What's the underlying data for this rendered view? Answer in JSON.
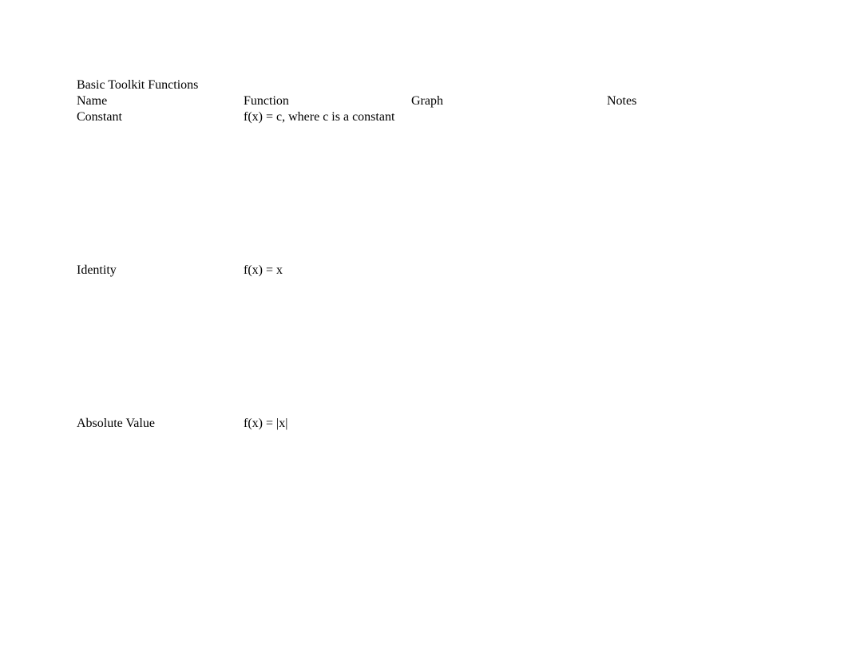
{
  "title": "Basic Toolkit Functions",
  "headers": {
    "name": "Name",
    "function": "Function",
    "graph": "Graph",
    "notes": "Notes"
  },
  "rows": [
    {
      "name": "Constant",
      "function": "f(x) = c, where c is a constant",
      "graph": "",
      "notes": ""
    },
    {
      "name": "Identity",
      "function": "f(x) = x",
      "graph": "",
      "notes": ""
    },
    {
      "name": "Absolute Value",
      "function": "f(x) = |x|",
      "graph": "",
      "notes": ""
    }
  ]
}
